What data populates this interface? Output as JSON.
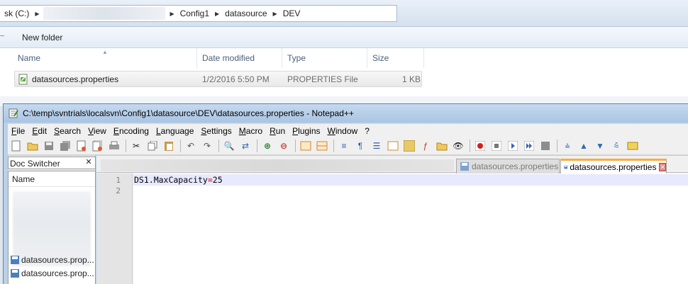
{
  "explorer": {
    "address": {
      "drive_fragment": "sk (C:)",
      "crumbs": [
        "Config1",
        "datasource",
        "DEV"
      ]
    },
    "toolbar": {
      "new_folder": "New folder"
    },
    "columns": {
      "name": "Name",
      "date_modified": "Date modified",
      "type": "Type",
      "size": "Size"
    },
    "files": [
      {
        "name": "datasources.properties",
        "date_modified": "1/2/2016 5:50 PM",
        "type": "PROPERTIES File",
        "size": "1 KB"
      }
    ]
  },
  "notepad": {
    "title": "C:\\temp\\svntrials\\localsvn\\Config1\\datasource\\DEV\\datasources.properties - Notepad++",
    "menu": [
      "File",
      "Edit",
      "Search",
      "View",
      "Encoding",
      "Language",
      "Settings",
      "Macro",
      "Run",
      "Plugins",
      "Window",
      "?"
    ],
    "doc_switcher": {
      "title": "Doc Switcher",
      "column": "Name",
      "items": [
        "datasources.prop...",
        "datasources.prop..."
      ]
    },
    "tabs": [
      {
        "label": "datasources.properties",
        "active": false
      },
      {
        "label": "datasources.properties",
        "active": true
      }
    ],
    "editor": {
      "line_numbers": [
        "1",
        "2"
      ],
      "line1": {
        "key": "DS1.MaxCapacity",
        "op": "=",
        "value": "25"
      }
    },
    "colors": {
      "accent_tab": "#fbab3c",
      "title_bar": "#b9d1ea",
      "operator": "#e00000"
    }
  }
}
